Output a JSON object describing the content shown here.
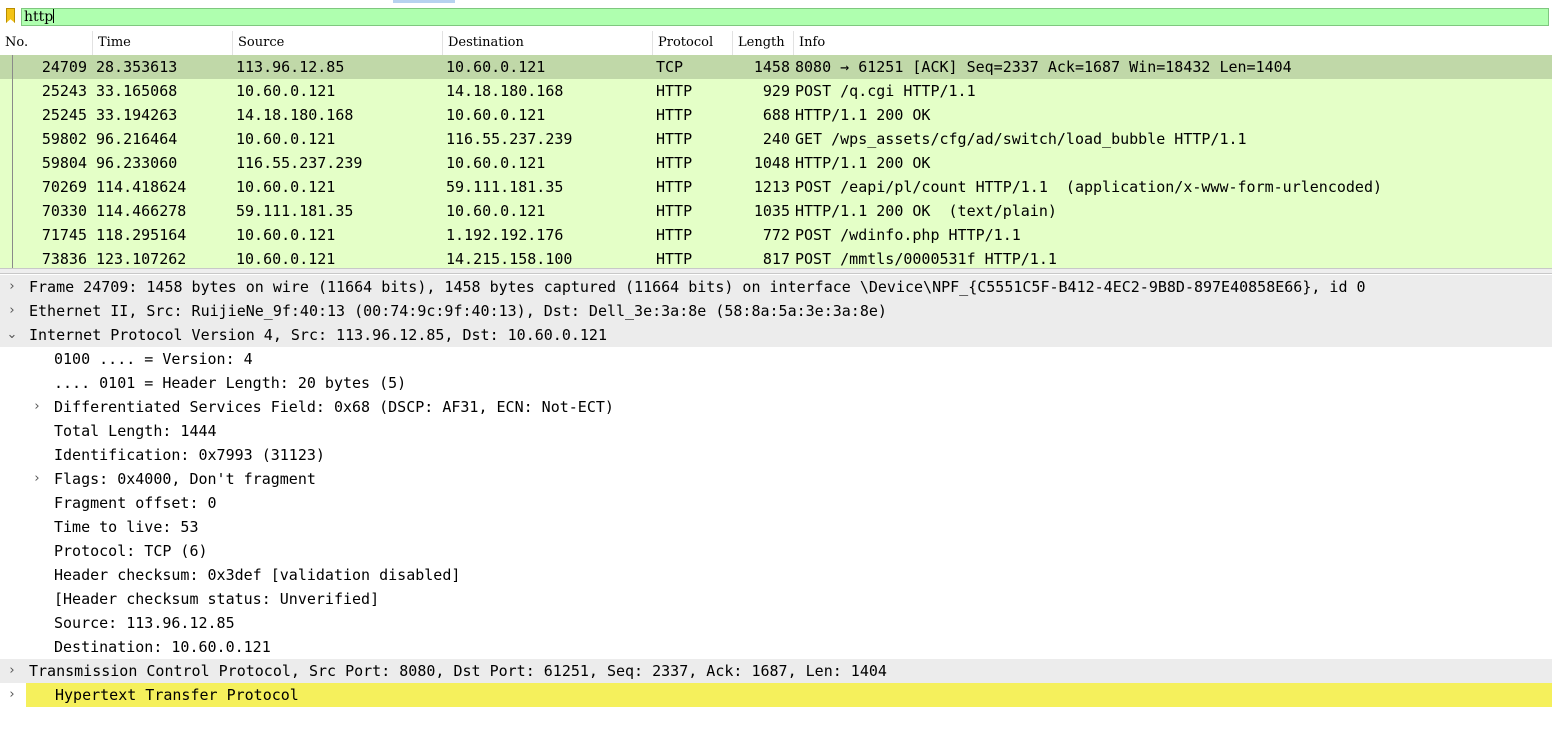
{
  "filter": {
    "value": "http"
  },
  "columns": [
    "No.",
    "Time",
    "Source",
    "Destination",
    "Protocol",
    "Length",
    "Info"
  ],
  "packets": [
    {
      "no": "24709",
      "time": "28.353613",
      "src": "113.96.12.85",
      "dst": "10.60.0.121",
      "proto": "TCP",
      "len": "1458",
      "info": "8080 → 61251 [ACK] Seq=2337 Ack=1687 Win=18432 Len=1404",
      "selected": true
    },
    {
      "no": "25243",
      "time": "33.165068",
      "src": "10.60.0.121",
      "dst": "14.18.180.168",
      "proto": "HTTP",
      "len": "929",
      "info": "POST /q.cgi HTTP/1.1"
    },
    {
      "no": "25245",
      "time": "33.194263",
      "src": "14.18.180.168",
      "dst": "10.60.0.121",
      "proto": "HTTP",
      "len": "688",
      "info": "HTTP/1.1 200 OK"
    },
    {
      "no": "59802",
      "time": "96.216464",
      "src": "10.60.0.121",
      "dst": "116.55.237.239",
      "proto": "HTTP",
      "len": "240",
      "info": "GET /wps_assets/cfg/ad/switch/load_bubble HTTP/1.1"
    },
    {
      "no": "59804",
      "time": "96.233060",
      "src": "116.55.237.239",
      "dst": "10.60.0.121",
      "proto": "HTTP",
      "len": "1048",
      "info": "HTTP/1.1 200 OK"
    },
    {
      "no": "70269",
      "time": "114.418624",
      "src": "10.60.0.121",
      "dst": "59.111.181.35",
      "proto": "HTTP",
      "len": "1213",
      "info": "POST /eapi/pl/count HTTP/1.1  (application/x-www-form-urlencoded)"
    },
    {
      "no": "70330",
      "time": "114.466278",
      "src": "59.111.181.35",
      "dst": "10.60.0.121",
      "proto": "HTTP",
      "len": "1035",
      "info": "HTTP/1.1 200 OK  (text/plain)"
    },
    {
      "no": "71745",
      "time": "118.295164",
      "src": "10.60.0.121",
      "dst": "1.192.192.176",
      "proto": "HTTP",
      "len": "772",
      "info": "POST /wdinfo.php HTTP/1.1"
    },
    {
      "no": "73836",
      "time": "123.107262",
      "src": "10.60.0.121",
      "dst": "14.215.158.100",
      "proto": "HTTP",
      "len": "817",
      "info": "POST /mmtls/0000531f HTTP/1.1"
    }
  ],
  "details": [
    {
      "level": 0,
      "arrow": "›",
      "text": "Frame 24709: 1458 bytes on wire (11664 bits), 1458 bytes captured (11664 bits) on interface \\Device\\NPF_{C5551C5F-B412-4EC2-9B8D-897E40858E66}, id 0"
    },
    {
      "level": 0,
      "arrow": "›",
      "text": "Ethernet II, Src: RuijieNe_9f:40:13 (00:74:9c:9f:40:13), Dst: Dell_3e:3a:8e (58:8a:5a:3e:3a:8e)"
    },
    {
      "level": 0,
      "arrow": "⌄",
      "text": "Internet Protocol Version 4, Src: 113.96.12.85, Dst: 10.60.0.121"
    },
    {
      "level": 1,
      "arrow": "",
      "text": "0100 .... = Version: 4"
    },
    {
      "level": 1,
      "arrow": "",
      "text": ".... 0101 = Header Length: 20 bytes (5)"
    },
    {
      "level": 1,
      "arrow": "›",
      "text": "Differentiated Services Field: 0x68 (DSCP: AF31, ECN: Not-ECT)"
    },
    {
      "level": 1,
      "arrow": "",
      "text": "Total Length: 1444"
    },
    {
      "level": 1,
      "arrow": "",
      "text": "Identification: 0x7993 (31123)"
    },
    {
      "level": 1,
      "arrow": "›",
      "text": "Flags: 0x4000, Don't fragment"
    },
    {
      "level": 1,
      "arrow": "",
      "text": "Fragment offset: 0"
    },
    {
      "level": 1,
      "arrow": "",
      "text": "Time to live: 53"
    },
    {
      "level": 1,
      "arrow": "",
      "text": "Protocol: TCP (6)"
    },
    {
      "level": 1,
      "arrow": "",
      "text": "Header checksum: 0x3def [validation disabled]"
    },
    {
      "level": 1,
      "arrow": "",
      "text": "[Header checksum status: Unverified]"
    },
    {
      "level": 1,
      "arrow": "",
      "text": "Source: 113.96.12.85"
    },
    {
      "level": 1,
      "arrow": "",
      "text": "Destination: 10.60.0.121"
    },
    {
      "level": 0,
      "arrow": "›",
      "text": "Transmission Control Protocol, Src Port: 8080, Dst Port: 61251, Seq: 2337, Ack: 1687, Len: 1404"
    },
    {
      "level": 0,
      "arrow": "›",
      "text": "Hypertext Transfer Protocol",
      "highlight": true
    }
  ],
  "colors": {
    "http_row": "#e4ffc7",
    "selected_row": "#c0d8a8",
    "filter_ok": "#afffaf",
    "highlight": "#f5f05c"
  }
}
